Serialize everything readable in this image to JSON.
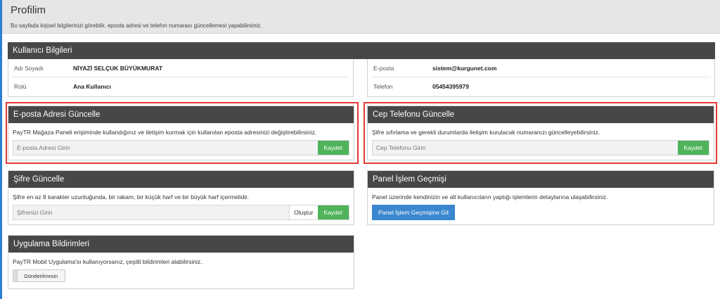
{
  "header": {
    "title": "Profilim",
    "subtitle": "Bu sayfada kişisel bilgilerinizi görebilir, eposta adresi ve telefon numarası güncellemesi yapabilirsiniz."
  },
  "user_info": {
    "title": "Kullanıcı Bilgileri",
    "left_rows": [
      {
        "label": "Adı Soyadı",
        "value": "NİYAZİ SELÇUK BÜYÜKMURAT"
      },
      {
        "label": "Rolü",
        "value": "Ana Kullanıcı"
      }
    ],
    "right_rows": [
      {
        "label": "E-posta",
        "value": "sistem@kurgunet.com"
      },
      {
        "label": "Telefon",
        "value": "05454395979"
      }
    ]
  },
  "email_update": {
    "title": "E-posta Adresi Güncelle",
    "description": "PayTR Mağaza Paneli erişiminde kullandığınız ve iletişim kurmak için kullanılan eposta adresinizi değiştirebilirsiniz.",
    "placeholder": "E-posta Adresi Girin",
    "button": "Kaydet"
  },
  "phone_update": {
    "title": "Cep Telefonu Güncelle",
    "description": "Şifre sıfırlama ve gerekli durumlarda iletişim kurulacak numaranızı güncelleyebilirsiniz.",
    "placeholder": "Cep Telefonu Girin",
    "button": "Kaydet"
  },
  "password_update": {
    "title": "Şifre Güncelle",
    "description": "Şifre en az 8 karakter uzunluğunda, bir rakam, bir küçük harf ve bir büyük harf içermelidir.",
    "placeholder": "Şifrenizi Girin",
    "generate": "Oluştur",
    "button": "Kaydet"
  },
  "history": {
    "title": "Panel İşlem Geçmişi",
    "description": "Panel üzerinde kendinizin ve alt kullanıcıların yaptığı işlemlerin detaylarına ulaşabilirsiniz.",
    "button": "Panel İşlem Geçmişine Git"
  },
  "notifications": {
    "title": "Uygulama Bildirimleri",
    "description": "PayTR Mobil Uygulama'sı kullanıyorsanız, çeşitli bildirimleri alabilirsiniz.",
    "toggle_label": "Gönderilmesin"
  },
  "colors": {
    "panel_header": "#474747",
    "save_button": "#4fb35b",
    "primary_button": "#3a87cf",
    "highlight": "#e53935",
    "left_accent": "#2c7fd1"
  }
}
